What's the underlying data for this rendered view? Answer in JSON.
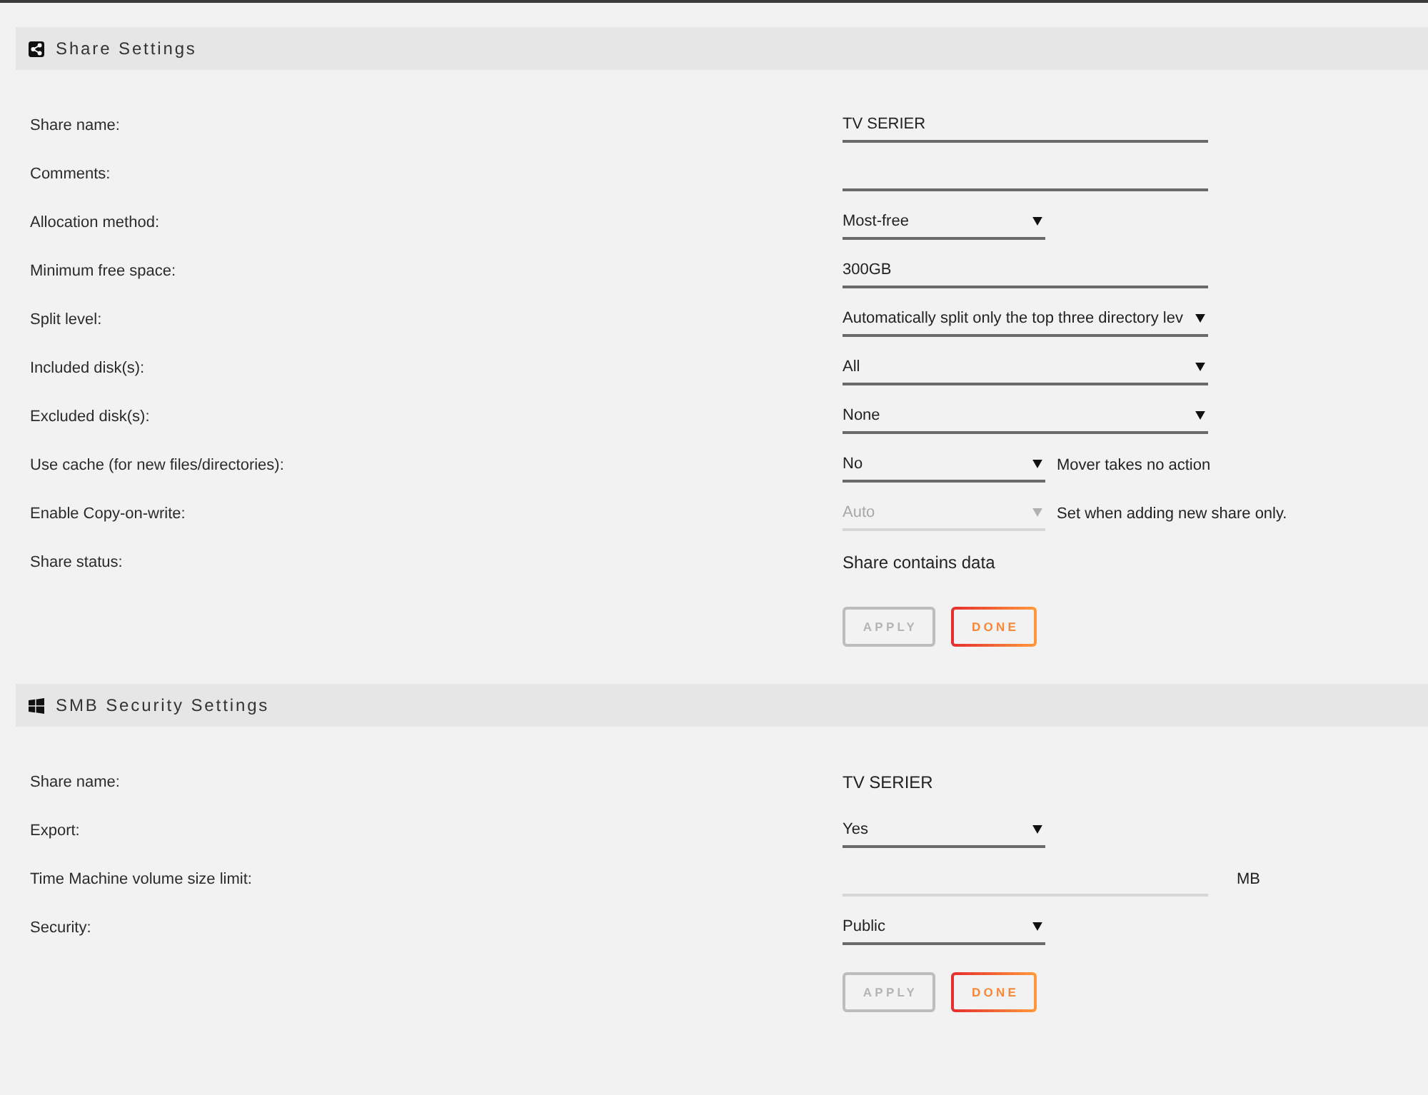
{
  "sections": [
    {
      "title": "Share Settings",
      "rows": [
        {
          "label": "Share name:",
          "kind": "input",
          "value": "TV SERIER",
          "disabled": false
        },
        {
          "label": "Comments:",
          "kind": "input",
          "disabled": false
        },
        {
          "label": "Allocation method:",
          "kind": "select",
          "value": "Most-free",
          "disabled": false
        },
        {
          "label": "Minimum free space:",
          "kind": "input",
          "value": "300GB",
          "disabled": false
        },
        {
          "label": "Split level:",
          "kind": "wideselect",
          "value": "Automatically split only the top three directory lev",
          "disabled": false
        },
        {
          "label": "Included disk(s):",
          "kind": "wideselect",
          "value": "All",
          "disabled": false
        },
        {
          "label": "Excluded disk(s):",
          "kind": "wideselect",
          "value": "None",
          "disabled": false
        },
        {
          "label": "Use cache (for new files/directories):",
          "kind": "select",
          "value": "No",
          "note": "Mover takes no action",
          "disabled": false
        },
        {
          "label": "Enable Copy-on-write:",
          "kind": "select",
          "value": "Auto",
          "note": "Set when adding new share only.",
          "disabled": true
        },
        {
          "label": "Share status:",
          "kind": "text",
          "value": "Share contains data",
          "disabled": false
        }
      ],
      "buttons": [
        {
          "label": "APPLY",
          "disabled": true
        },
        {
          "label": "DONE",
          "disabled": false
        }
      ]
    },
    {
      "title": "SMB Security Settings",
      "rows": [
        {
          "label": "Share name:",
          "kind": "text",
          "value": "TV SERIER",
          "disabled": false
        },
        {
          "label": "Export:",
          "kind": "select",
          "value": "Yes",
          "disabled": false
        },
        {
          "label": "Time Machine volume size limit:",
          "kind": "input",
          "note": "MB",
          "disabled": true
        },
        {
          "label": "Security:",
          "kind": "select",
          "value": "Public",
          "disabled": false
        }
      ],
      "buttons": [
        {
          "label": "APPLY",
          "disabled": true
        },
        {
          "label": "DONE",
          "disabled": false
        }
      ]
    }
  ]
}
